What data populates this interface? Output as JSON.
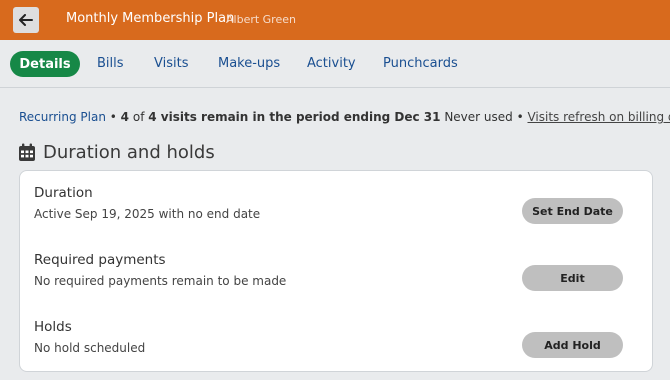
{
  "header": {
    "back_icon": "arrow-left-icon",
    "title": "Monthly Membership Plan",
    "member_name": "Albert Green",
    "bg_color": "#d86a1d"
  },
  "tabs": [
    {
      "label": "Details",
      "active": true
    },
    {
      "label": "Bills"
    },
    {
      "label": "Visits"
    },
    {
      "label": "Make-ups"
    },
    {
      "label": "Activity"
    },
    {
      "label": "Punchcards"
    }
  ],
  "summary": {
    "plan_link": "Recurring Plan",
    "sep1": " • ",
    "visits_text": "4 of 4 visits remain in the period ending Dec 31",
    "visits_remaining": "4",
    "of": " of ",
    "visits_total": "4",
    "period_text": " visits remain in the period ending Dec 31",
    "usage": " Never used",
    "sep2": " • ",
    "refresh_link": "Visits refresh on billing day"
  },
  "section": {
    "icon": "calendar-icon",
    "title": "Duration and holds"
  },
  "rows": [
    {
      "title": "Duration",
      "desc": "Active Sep 19, 2025 with no end date",
      "button": "Set End Date"
    },
    {
      "title": "Required payments",
      "desc": "No required payments remain to be made",
      "button": "Edit"
    },
    {
      "title": "Holds",
      "desc": "No hold scheduled",
      "button": "Add Hold"
    }
  ],
  "colors": {
    "accent_green": "#168847",
    "link_blue": "#1a4f91"
  }
}
